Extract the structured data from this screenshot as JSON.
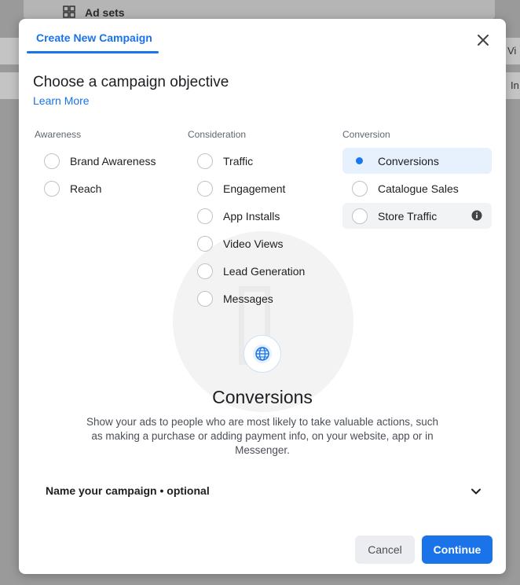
{
  "background": {
    "adsets_label": "Ad sets",
    "right_tab_1": "Vi",
    "right_tab_2": "In"
  },
  "modal": {
    "tab_label": "Create New Campaign",
    "title": "Choose a campaign objective",
    "learn_more": "Learn More",
    "columns": [
      {
        "heading": "Awareness",
        "options": [
          "Brand Awareness",
          "Reach"
        ]
      },
      {
        "heading": "Consideration",
        "options": [
          "Traffic",
          "Engagement",
          "App Installs",
          "Video Views",
          "Lead Generation",
          "Messages"
        ]
      },
      {
        "heading": "Conversion",
        "options": [
          "Conversions",
          "Catalogue Sales",
          "Store Traffic"
        ]
      }
    ],
    "selected_option": "Conversions",
    "detail": {
      "title": "Conversions",
      "description": "Show your ads to people who are most likely to take valuable actions, such as making a purchase or adding payment info, on your website, app or in Messenger."
    },
    "name_campaign_label": "Name your campaign • optional",
    "cancel_label": "Cancel",
    "continue_label": "Continue"
  },
  "colors": {
    "accent": "#1a73e8",
    "selected_bg": "#e7f0fd"
  },
  "icons": {
    "adsets": "grid-icon",
    "close": "close-icon",
    "info": "info-icon",
    "detail": "globe-icon",
    "chevron": "chevron-down-icon"
  }
}
